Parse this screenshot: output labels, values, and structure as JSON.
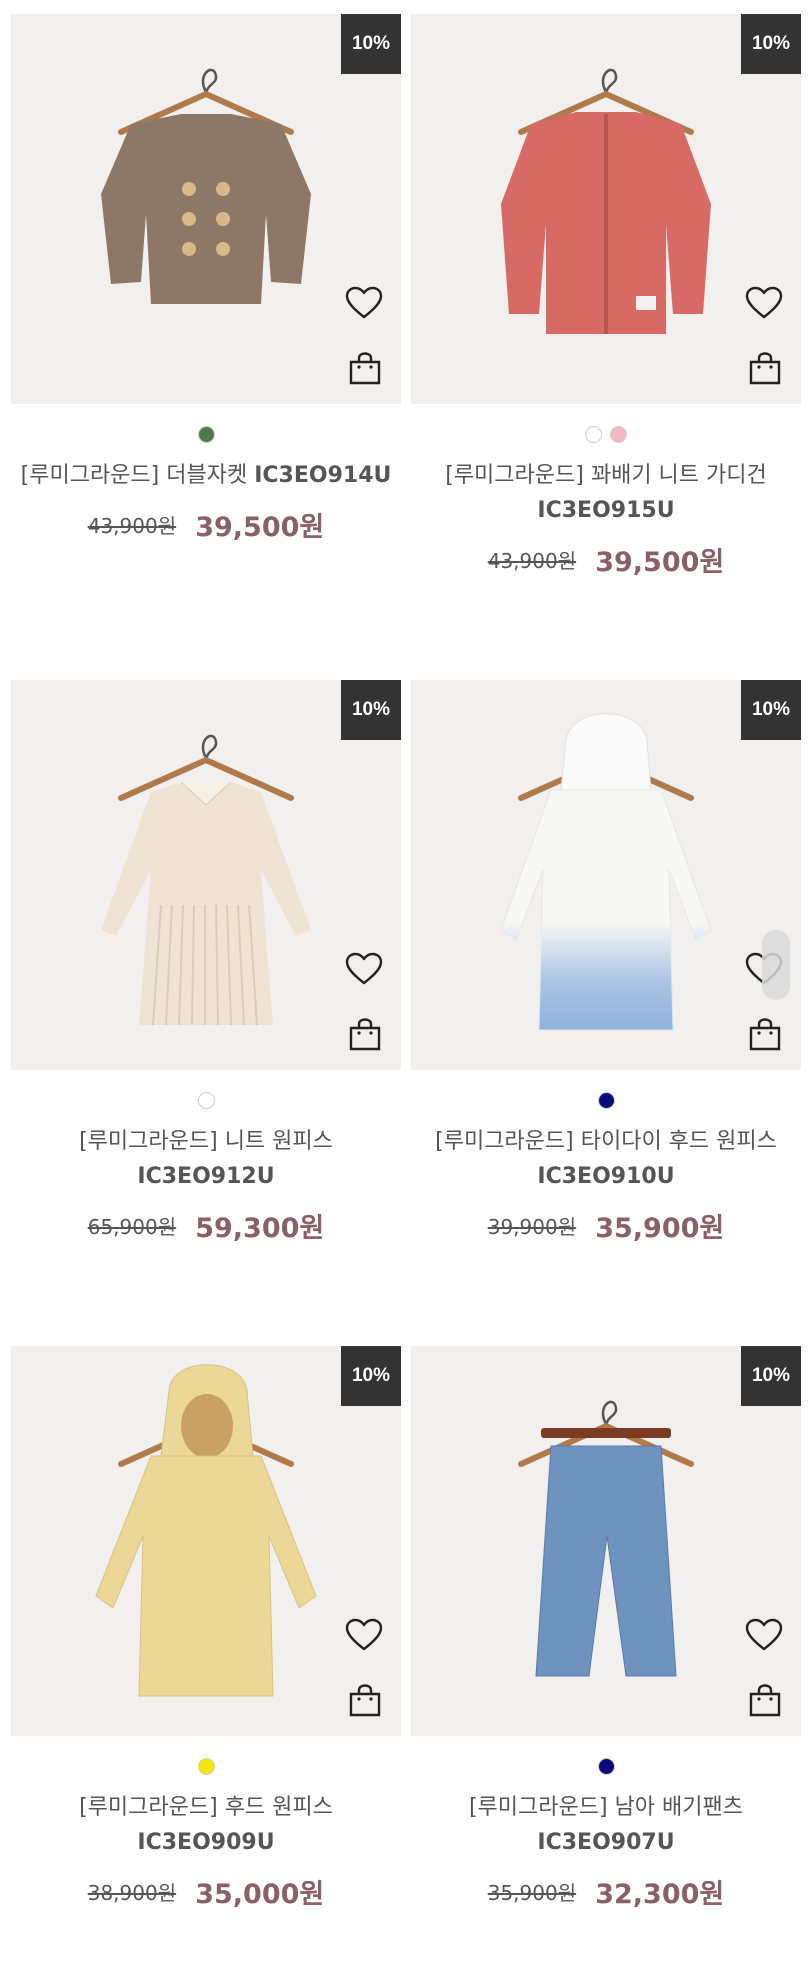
{
  "products": [
    {
      "discount": "10%",
      "swatches": [
        "#4e7a4a"
      ],
      "name": "[루미그라운드] 더블자켓",
      "code": "IC3EO914U",
      "original_price": "43,900원",
      "sale_price": "39,500원",
      "garment_color": "#8d7766",
      "garment_type": "jacket"
    },
    {
      "discount": "10%",
      "swatches": [
        "#ffffff",
        "#f4b8c0"
      ],
      "name": "[루미그라운드] 꽈배기 니트 가디건",
      "code": "IC3EO915U",
      "original_price": "43,900원",
      "sale_price": "39,500원",
      "garment_color": "#d86a66",
      "garment_type": "cardigan"
    },
    {
      "discount": "10%",
      "swatches": [
        "#ffffff"
      ],
      "name": "[루미그라운드] 니트 원피스",
      "code": "IC3EO912U",
      "original_price": "65,900원",
      "sale_price": "59,300원",
      "garment_color": "#efe4d3",
      "garment_type": "dress"
    },
    {
      "discount": "10%",
      "swatches": [
        "#0a0a7a"
      ],
      "name": "[루미그라운드] 타이다이 후드 원피스",
      "code": "IC3EO910U",
      "original_price": "39,900원",
      "sale_price": "35,900원",
      "garment_color": "#f7f7f5",
      "garment_type": "hood-dress-tiedye"
    },
    {
      "discount": "10%",
      "swatches": [
        "#f5e600"
      ],
      "name": "[루미그라운드] 후드 원피스",
      "code": "IC3EO909U",
      "original_price": "38,900원",
      "sale_price": "35,000원",
      "garment_color": "#ecd896",
      "garment_type": "hood-dress"
    },
    {
      "discount": "10%",
      "swatches": [
        "#0a0a7a"
      ],
      "name": "[루미그라운드] 남아 배기팬츠",
      "code": "IC3EO907U",
      "original_price": "35,900원",
      "sale_price": "32,300원",
      "garment_color": "#6f93bf",
      "garment_type": "pants"
    }
  ],
  "icons": {
    "wishlist": "heart-icon",
    "cart": "shopping-bag-icon"
  },
  "colors": {
    "badge_bg": "#333333",
    "sale_price": "#8a6068",
    "image_bg": "#f2f0ee"
  }
}
